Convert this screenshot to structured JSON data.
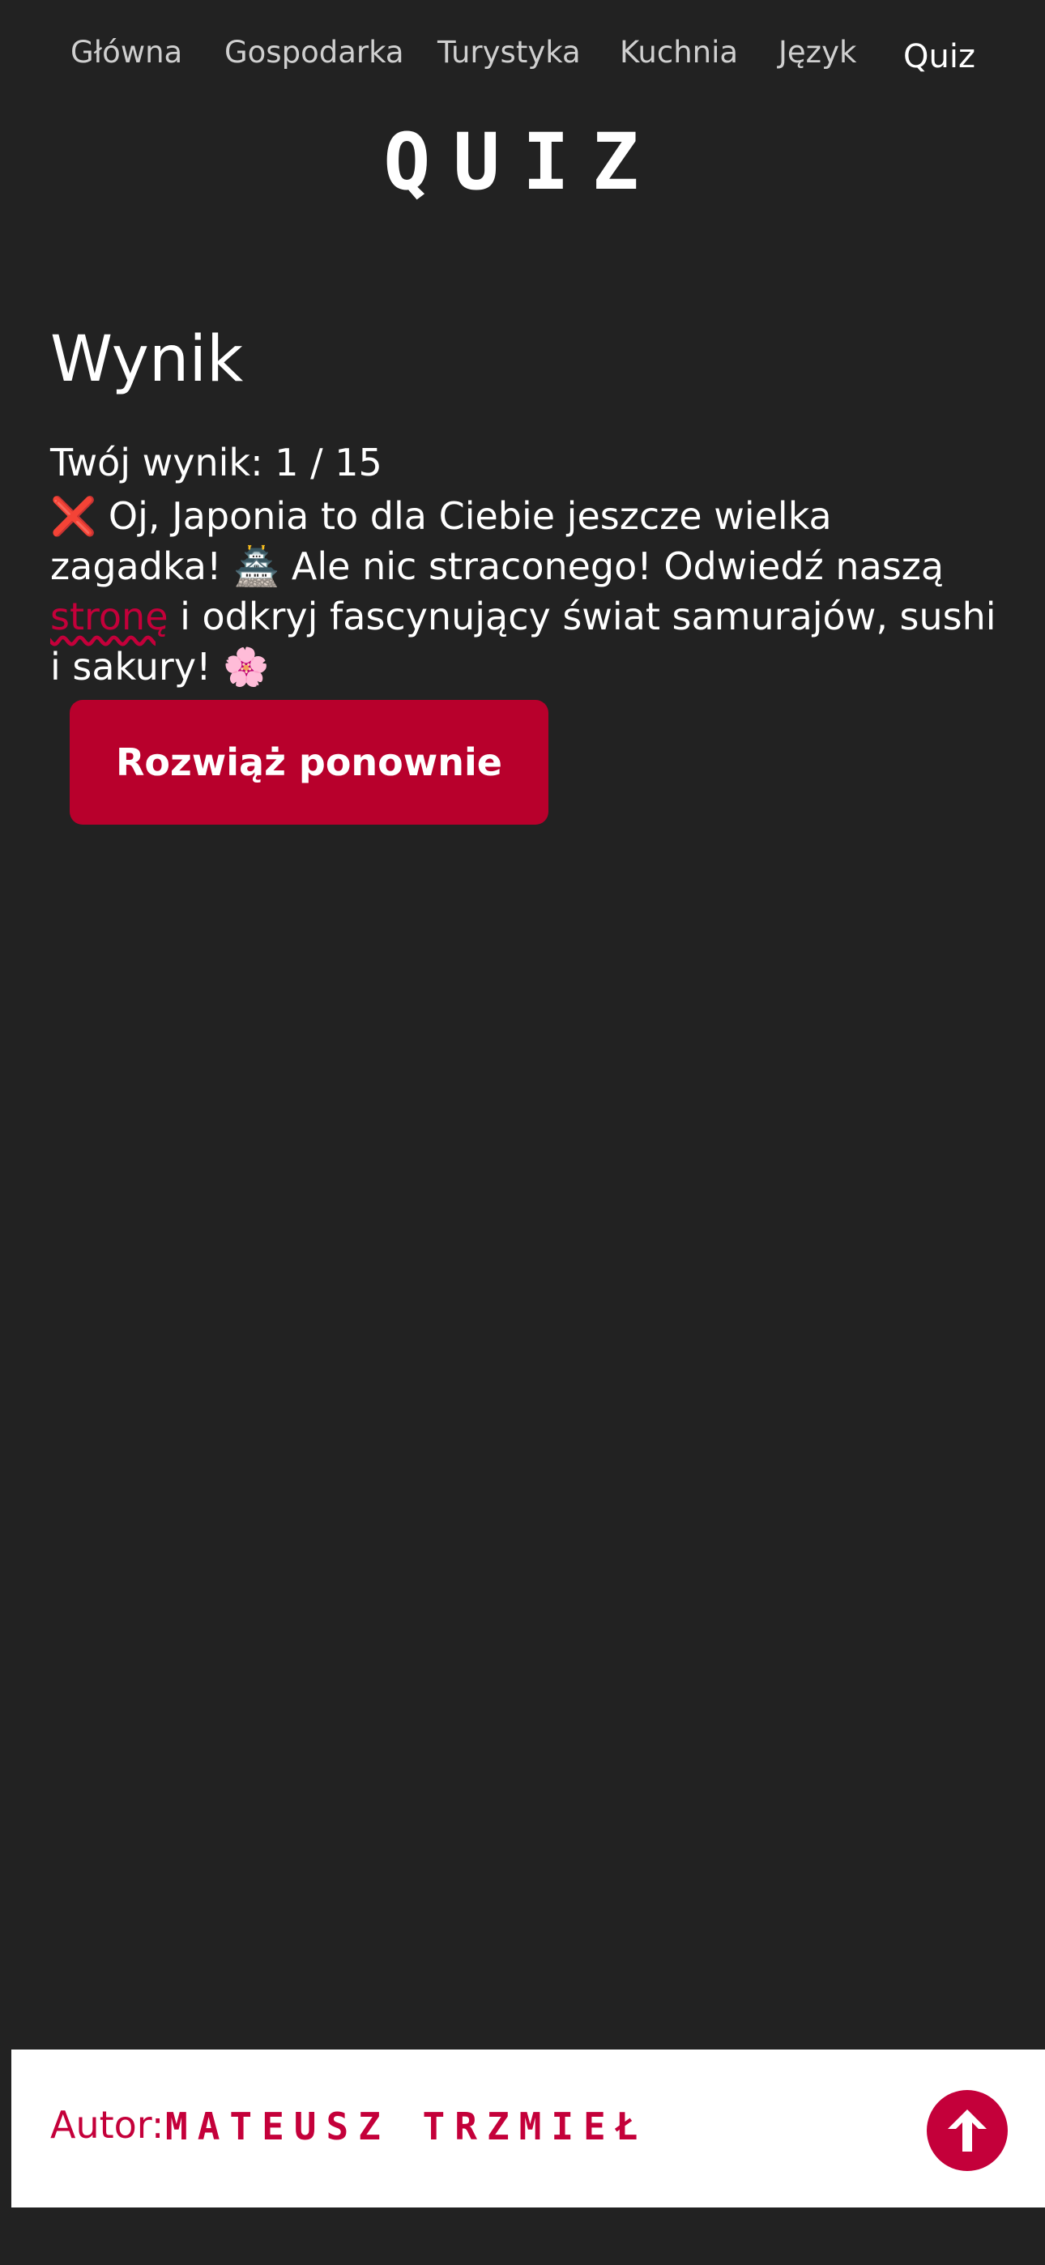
{
  "nav": {
    "items": [
      {
        "label": "Główna"
      },
      {
        "label": "Gospodarka"
      },
      {
        "label": "Turystyka"
      },
      {
        "label": "Kuchnia"
      },
      {
        "label": "Język"
      },
      {
        "label": "Quiz"
      }
    ],
    "active": "Quiz"
  },
  "logo": {
    "text": "QUIZ"
  },
  "result": {
    "heading": "Wynik",
    "score": "Twój wynik: 1 / 15",
    "icon": "❌",
    "line1": "Oj, Japonia to dla Ciebie jeszcze wielka zagadka!",
    "pagoda": "🏯",
    "line2_before": "Ale nic straconego! Odwiedź naszą",
    "link": "stronę",
    "line2_after": "i odkryj fascynujący świat samurajów, sushi i sakury!",
    "flower": "🌸"
  },
  "retry_button": {
    "label": "Rozwiąż ponownie"
  },
  "footer": {
    "author_label": "Autor:",
    "author_name": "MATEUSZ TRZMIEŁ"
  },
  "colors": {
    "background": "#222222",
    "accent": "#c4003a",
    "button": "#b8002c"
  }
}
